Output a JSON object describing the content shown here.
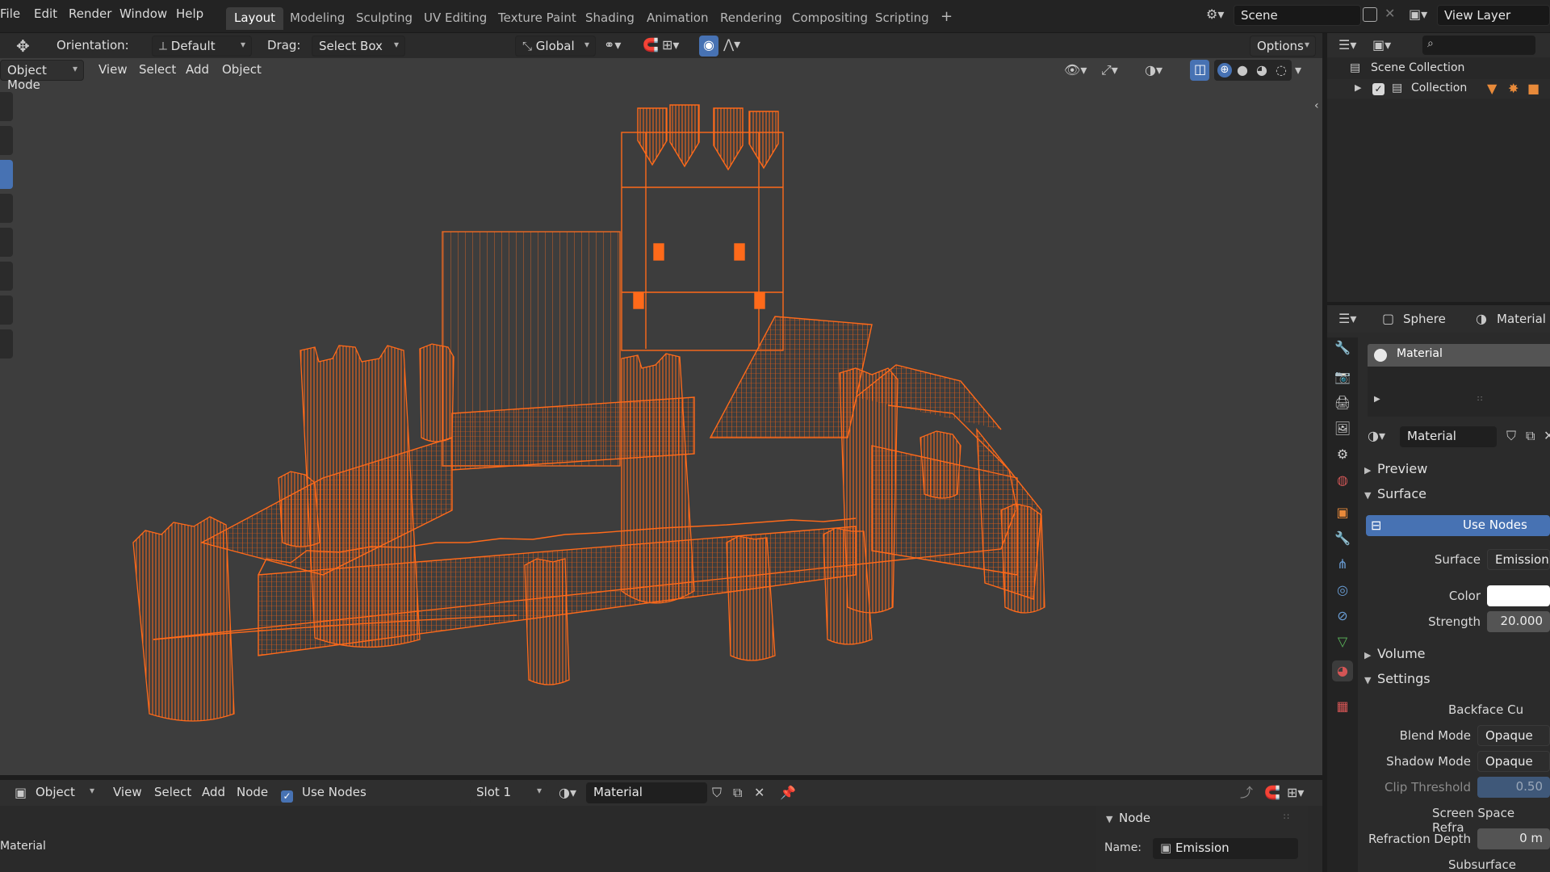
{
  "topbar": {
    "menus": [
      "File",
      "Edit",
      "Render",
      "Window",
      "Help"
    ],
    "workspaces": [
      "Layout",
      "Modeling",
      "Sculpting",
      "UV Editing",
      "Texture Paint",
      "Shading",
      "Animation",
      "Rendering",
      "Compositing",
      "Scripting"
    ],
    "add_workspace": "+",
    "scene_label": "Scene",
    "view_layer_label": "View Layer"
  },
  "tool_header": {
    "orientation_label": "Orientation:",
    "orientation_value": "Default",
    "drag_label": "Drag:",
    "drag_value": "Select Box",
    "transform_orientation": "Global",
    "options_label": "Options"
  },
  "viewport_header": {
    "mode": "Object Mode",
    "menus": [
      "View",
      "Select",
      "Add",
      "Object"
    ]
  },
  "outliner": {
    "scene_collection": "Scene Collection",
    "collection": "Collection"
  },
  "properties": {
    "object_name": "Sphere",
    "material_tab": "Material",
    "slot_material": "Material",
    "material_name": "Material",
    "use_nodes": "Use Nodes",
    "sections": {
      "preview": "Preview",
      "surface": "Surface",
      "volume": "Volume",
      "settings": "Settings"
    },
    "surface_label": "Surface",
    "surface_value": "Emission",
    "color_label": "Color",
    "strength_label": "Strength",
    "strength_value": "20.000",
    "backface_label": "Backface Cu",
    "blend_mode_label": "Blend Mode",
    "blend_mode_value": "Opaque",
    "shadow_mode_label": "Shadow Mode",
    "shadow_mode_value": "Opaque",
    "clip_threshold_label": "Clip Threshold",
    "clip_threshold_value": "0.50",
    "screen_space_label": "Screen Space Refra",
    "refraction_depth_label": "Refraction Depth",
    "refraction_depth_value": "0 m",
    "subsurface_label": "Subsurface Transluc"
  },
  "node_header": {
    "type": "Object",
    "menus": [
      "View",
      "Select",
      "Add",
      "Node"
    ],
    "use_nodes": "Use Nodes",
    "slot": "Slot 1",
    "material": "Material"
  },
  "node_editor": {
    "breadcrumb": "Material",
    "panel_title": "Node",
    "name_label": "Name:",
    "name_value": "Emission"
  },
  "colors": {
    "accent": "#4772b3",
    "wire": "#ff6a1a",
    "viewport_bg": "#3d3d3d"
  }
}
